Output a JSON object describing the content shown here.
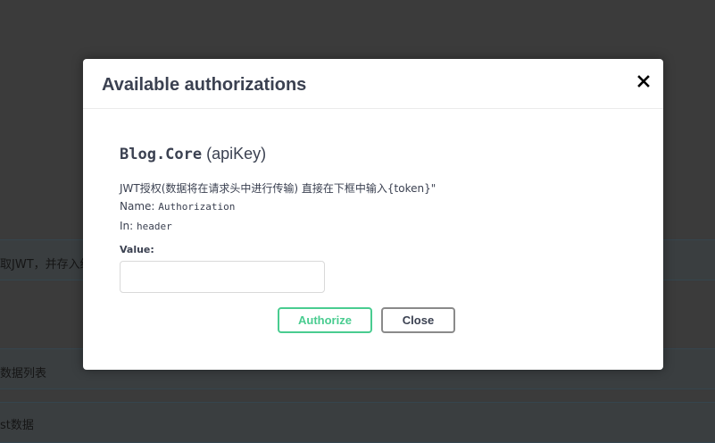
{
  "background": {
    "row1_text": "取JWT，并存入缓",
    "row2_text": "数据列表",
    "row3_text": "st数据"
  },
  "modal": {
    "title": "Available authorizations",
    "close_icon": "close-icon",
    "scheme": {
      "name": "Blog.Core",
      "type": "(apiKey)",
      "description": "JWT授权(数据将在请求头中进行传输) 直接在下框中输入{token}\"",
      "name_label": "Name:",
      "name_value": "Authorization",
      "in_label": "In:",
      "in_value": "header",
      "value_label": "Value:",
      "value_input": "",
      "value_placeholder": ""
    },
    "buttons": {
      "authorize_label": "Authorize",
      "close_label": "Close"
    }
  },
  "colors": {
    "authorize": "#49cc90",
    "overlay": "#3b3b3b"
  }
}
